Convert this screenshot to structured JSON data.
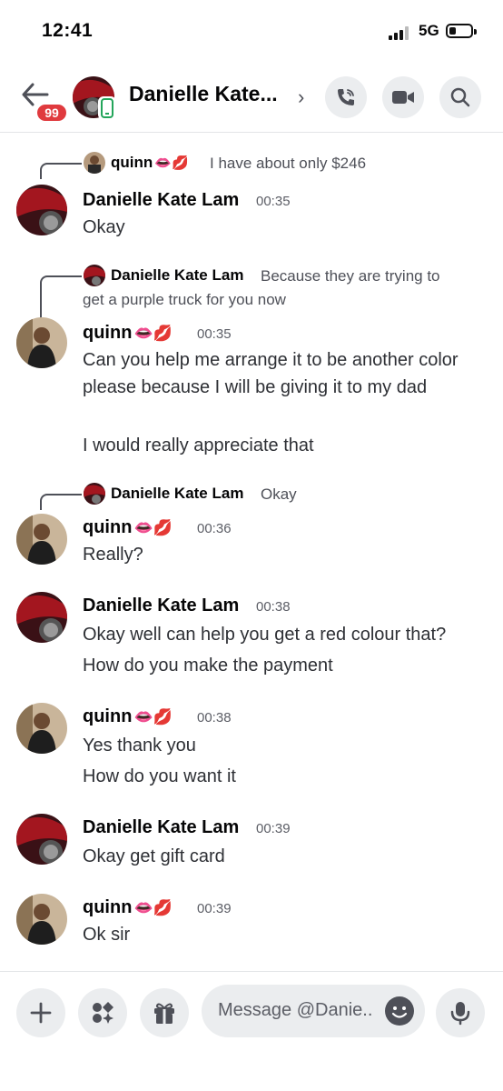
{
  "status_bar": {
    "time": "12:41",
    "network": "5G"
  },
  "header": {
    "badge_count": "99",
    "title": "Danielle Kate..."
  },
  "messages": [
    {
      "reply_name": "quinn",
      "reply_emoji": "👄💋",
      "reply_text": "I have about only $246",
      "author": "Danielle Kate Lam",
      "emoji": "",
      "time": "00:35",
      "lines": [
        "Okay"
      ]
    },
    {
      "reply_name": "Danielle Kate Lam",
      "reply_text": "Because they are trying to",
      "reply_text_2": "get a purple truck for you now",
      "author": "quinn",
      "emoji": "👄💋",
      "time": "00:35",
      "lines": [
        "Can you help me arrange it to be another color please because I will be giving it to my dad",
        "I would really appreciate that"
      ]
    },
    {
      "reply_name": "Danielle Kate Lam",
      "reply_text": "Okay",
      "author": "quinn",
      "emoji": "👄💋",
      "time": "00:36",
      "lines": [
        "Really?"
      ]
    },
    {
      "author": "Danielle Kate Lam",
      "time": "00:38",
      "lines": [
        "Okay well can help you get a red colour that?",
        "How do you make the payment"
      ]
    },
    {
      "author": "quinn",
      "emoji": "👄💋",
      "time": "00:38",
      "lines": [
        "Yes thank you",
        "How do you want it"
      ]
    },
    {
      "author": "Danielle Kate Lam",
      "time": "00:39",
      "lines": [
        "Okay get gift card"
      ]
    },
    {
      "author": "quinn",
      "emoji": "👄💋",
      "time": "00:39",
      "lines": [
        "Ok sir"
      ]
    }
  ],
  "composer": {
    "placeholder": "Message @Danie.."
  },
  "icons": [
    "back-arrow-icon",
    "mobile-icon",
    "chevron-right-icon",
    "phone-call-icon",
    "video-camera-icon",
    "search-icon",
    "plus-icon",
    "apps-icon",
    "gift-icon",
    "emoji-icon",
    "microphone-icon"
  ],
  "colors": {
    "badge": "#e03a3e",
    "online_mobile": "#23a55a",
    "button_bg": "#ebedef"
  }
}
